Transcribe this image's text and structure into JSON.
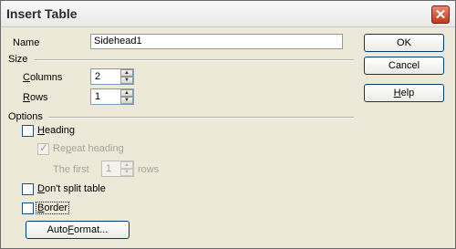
{
  "window": {
    "title": "Insert Table",
    "close_symbol": "✕"
  },
  "name_field": {
    "label": "Name",
    "value": "Sidehead1"
  },
  "size": {
    "section_label": "Size",
    "columns": {
      "label_u": "C",
      "label_rest": "olumns",
      "value": "2"
    },
    "rows": {
      "label_u": "R",
      "label_rest": "ows",
      "value": "1"
    }
  },
  "options": {
    "section_label": "Options",
    "heading": {
      "label_u": "H",
      "label_rest": "eading",
      "checked": false
    },
    "repeat_heading": {
      "label_pre": "Re",
      "label_u": "p",
      "label_rest": "eat heading",
      "checked": true
    },
    "first_rows": {
      "label_pre": "The first",
      "value": "1",
      "label_post": "rows"
    },
    "dont_split": {
      "label_u": "D",
      "label_rest": "on't split table",
      "checked": false
    },
    "border": {
      "label_u": "B",
      "label_rest": "order",
      "checked": false
    },
    "autoformat": {
      "label_pre": "Auto",
      "label_u": "F",
      "label_rest": "ormat..."
    }
  },
  "buttons": {
    "ok": "OK",
    "cancel": "Cancel",
    "help_u": "H",
    "help_rest": "elp"
  },
  "colors": {
    "dialog_bg": "#ece9d8",
    "input_border": "#7f9db9",
    "button_border": "#003c74"
  }
}
